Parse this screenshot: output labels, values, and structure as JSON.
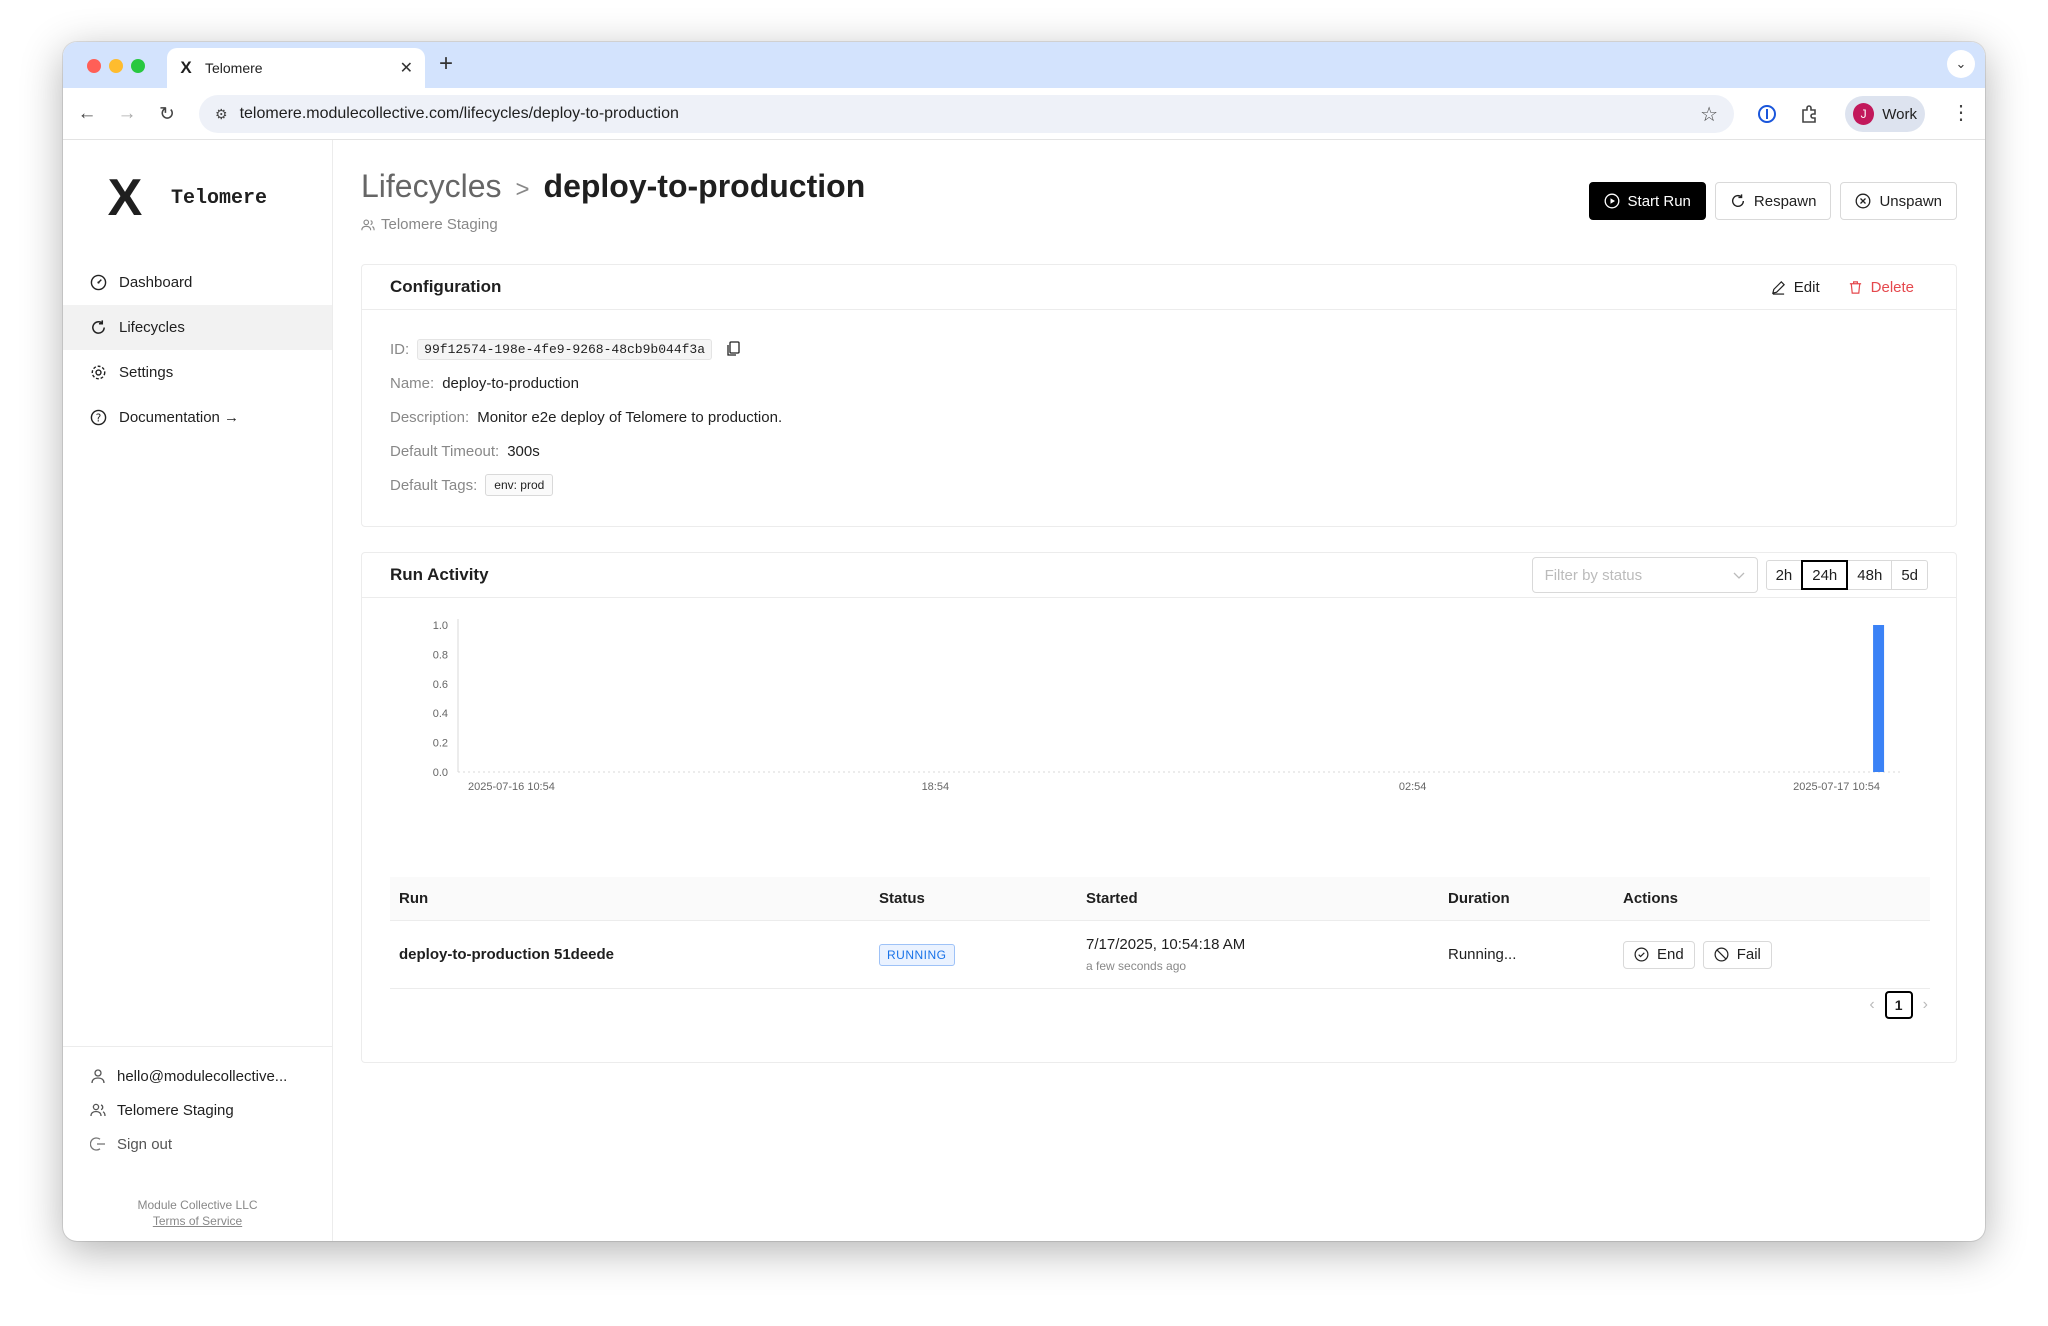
{
  "browser": {
    "tab_title": "Telomere",
    "tab_favicon": "X",
    "url": "telomere.modulecollective.com/lifecycles/deploy-to-production",
    "profile_initial": "J",
    "profile_name": "Work",
    "profile_color": "#c2185b"
  },
  "sidebar": {
    "brand": "Telomere",
    "brand_mark": "X",
    "nav": [
      {
        "label": "Dashboard",
        "icon": "dashboard-icon"
      },
      {
        "label": "Lifecycles",
        "icon": "refresh-icon"
      },
      {
        "label": "Settings",
        "icon": "gear-icon"
      },
      {
        "label": "Documentation →",
        "icon": "help-icon"
      }
    ],
    "active_index": 1,
    "user_email": "hello@modulecollective...",
    "workspace": "Telomere Staging",
    "sign_out": "Sign out",
    "company": "Module Collective LLC",
    "terms": "Terms of Service"
  },
  "header": {
    "breadcrumb_parent": "Lifecycles",
    "breadcrumb_sep": ">",
    "title": "deploy-to-production",
    "workspace": "Telomere Staging",
    "start_run": "Start Run",
    "respawn": "Respawn",
    "unspawn": "Unspawn"
  },
  "config": {
    "title": "Configuration",
    "edit": "Edit",
    "delete": "Delete",
    "id_label": "ID:",
    "id": "99f12574-198e-4fe9-9268-48cb9b044f3a",
    "name_label": "Name:",
    "name": "deploy-to-production",
    "description_label": "Description:",
    "description": "Monitor e2e deploy of Telomere to production.",
    "timeout_label": "Default Timeout:",
    "timeout": "300s",
    "tags_label": "Default Tags:",
    "tag": "env: prod"
  },
  "activity": {
    "title": "Run Activity",
    "filter_placeholder": "Filter by status",
    "ranges": [
      "2h",
      "24h",
      "48h",
      "5d"
    ],
    "selected_range": "24h"
  },
  "chart_data": {
    "type": "bar",
    "y_ticks": [
      "1.0",
      "0.8",
      "0.6",
      "0.4",
      "0.2",
      "0.0"
    ],
    "ylim": [
      0,
      1
    ],
    "x_ticks": [
      "2025-07-16 10:54",
      "18:54",
      "02:54",
      "2025-07-17 10:54"
    ],
    "x_tick_hours": [
      0,
      8,
      16,
      24
    ],
    "bars": [
      {
        "hour": 23.8,
        "value": 1.0
      }
    ],
    "bar_color": "#3b82f6",
    "grid": false
  },
  "runs": {
    "headers": [
      "Run",
      "Status",
      "Started",
      "Duration",
      "Actions"
    ],
    "rows": [
      {
        "name": "deploy-to-production 51deede",
        "status": "RUNNING",
        "started": "7/17/2025, 10:54:18 AM",
        "started_relative": "a few seconds ago",
        "duration": "Running...",
        "action_end": "End",
        "action_fail": "Fail"
      }
    ],
    "page": "1"
  }
}
